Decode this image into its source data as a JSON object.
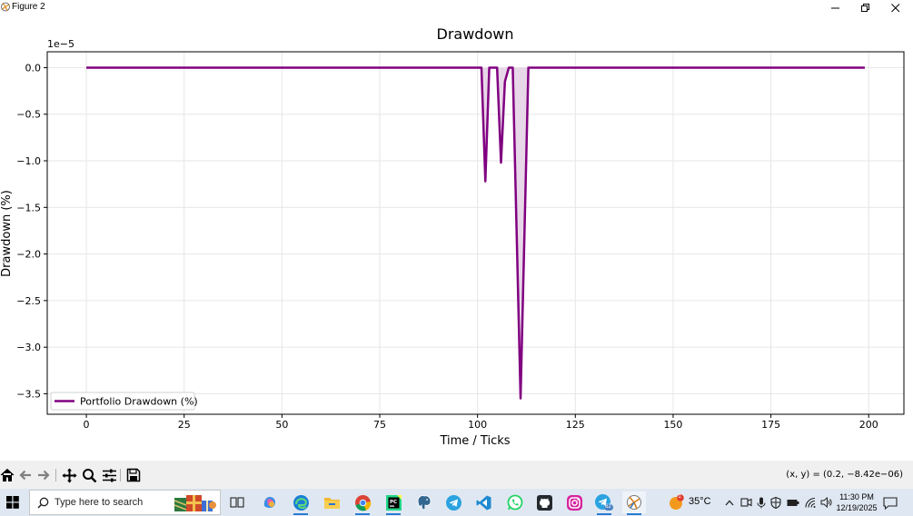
{
  "window": {
    "title": "Figure 2",
    "controls": [
      "minimize",
      "maximize",
      "close"
    ]
  },
  "chart_data": {
    "type": "line",
    "title": "Drawdown",
    "xlabel": "Time / Ticks",
    "ylabel": "Drawdown (%)",
    "y_scale_label": "1e−5",
    "xlim": [
      -10,
      209
    ],
    "ylim": [
      -3.72,
      0.17
    ],
    "x_ticks": [
      0,
      25,
      50,
      75,
      100,
      125,
      150,
      175,
      200
    ],
    "x_tick_labels": [
      "0",
      "25",
      "50",
      "75",
      "100",
      "125",
      "150",
      "175",
      "200"
    ],
    "y_ticks": [
      0.0,
      -0.5,
      -1.0,
      -1.5,
      -2.0,
      -2.5,
      -3.0,
      -3.5
    ],
    "y_tick_labels": [
      "0.0",
      "−0.5",
      "−1.0",
      "−1.5",
      "−2.0",
      "−2.5",
      "−3.0",
      "−3.5"
    ],
    "grid": true,
    "legend_position": "lower-left",
    "series": [
      {
        "name": "Portfolio Drawdown (%)",
        "color": "#800080",
        "fill_color": "#e8d7e8",
        "points": [
          [
            0,
            0
          ],
          [
            101,
            0
          ],
          [
            102,
            -1.22
          ],
          [
            103,
            0
          ],
          [
            105,
            0
          ],
          [
            106,
            -1.02
          ],
          [
            107,
            -0.15
          ],
          [
            108,
            0
          ],
          [
            109,
            0
          ],
          [
            111,
            -3.55
          ],
          [
            113,
            0
          ],
          [
            199,
            0
          ]
        ]
      }
    ]
  },
  "toolbar": {
    "buttons": [
      "home-icon",
      "back-icon",
      "forward-icon",
      "pan-icon",
      "zoom-icon",
      "configure-icon",
      "save-icon"
    ],
    "coords": "(x, y) = (0.2, −8.42e−06)"
  },
  "taskbar": {
    "search_placeholder": "Type here to search",
    "apps": [
      "task-view",
      "copilot",
      "edge",
      "file-explorer",
      "chrome",
      "pycharm",
      "postgres",
      "telegram",
      "vscode",
      "whatsapp",
      "github",
      "instagram",
      "telegram-badge",
      "python-figure"
    ],
    "weather": {
      "temp": "35°C",
      "badge": "1"
    },
    "telegram_badge": "62",
    "time": "11:30 PM",
    "date": "12/19/2025"
  }
}
